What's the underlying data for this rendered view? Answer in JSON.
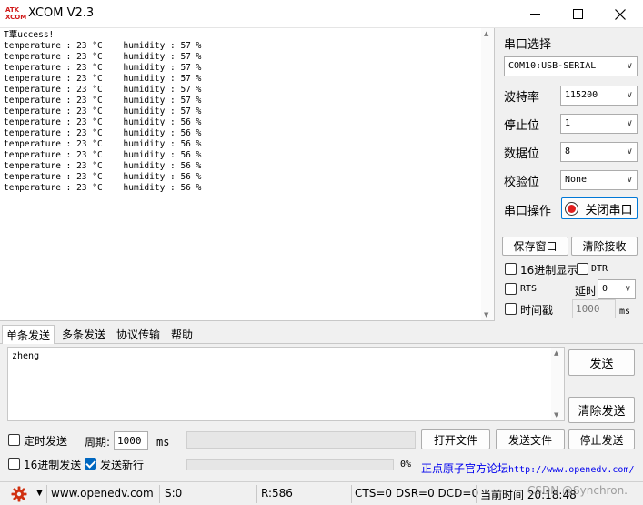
{
  "window": {
    "title": "XCOM V2.3",
    "logo_line1": "ATK",
    "logo_line2": "XCOM"
  },
  "receive": {
    "lines": [
      "T覃uccess!",
      "temperature : 23 °C    humidity : 57 %",
      "temperature : 23 °C    humidity : 57 %",
      "temperature : 23 °C    humidity : 57 %",
      "temperature : 23 °C    humidity : 57 %",
      "temperature : 23 °C    humidity : 57 %",
      "temperature : 23 °C    humidity : 57 %",
      "temperature : 23 °C    humidity : 57 %",
      "temperature : 23 °C    humidity : 56 %",
      "temperature : 23 °C    humidity : 56 %",
      "temperature : 23 °C    humidity : 56 %",
      "temperature : 23 °C    humidity : 56 %",
      "temperature : 23 °C    humidity : 56 %",
      "temperature : 23 °C    humidity : 56 %",
      "temperature : 23 °C    humidity : 56 %"
    ]
  },
  "right_panel": {
    "port_select_label": "串口选择",
    "port_value": "COM10:USB-SERIAL",
    "baud_label": "波特率",
    "baud_value": "115200",
    "stopbit_label": "停止位",
    "stopbit_value": "1",
    "databit_label": "数据位",
    "databit_value": "8",
    "parity_label": "校验位",
    "parity_value": "None",
    "port_op_label": "串口操作",
    "close_port_button": "关闭串口",
    "save_window_button": "保存窗口",
    "clear_receive_button": "清除接收",
    "hex_display_label": "16进制显示",
    "dtr_label": "DTR",
    "rts_label": "RTS",
    "delay_label": "延时",
    "delay_value": "0",
    "timestamp_label": "时间戳",
    "timestamp_value": "1000",
    "timestamp_unit": "ms"
  },
  "tabs": [
    "单条发送",
    "多条发送",
    "协议传输",
    "帮助"
  ],
  "send": {
    "text": "zheng",
    "send_button": "发送",
    "clear_send_button": "清除发送",
    "timed_send_label": "定时发送",
    "period_label": "周期:",
    "period_value": "1000",
    "period_unit": "ms",
    "open_file_button": "打开文件",
    "send_file_button": "发送文件",
    "stop_send_button": "停止发送",
    "hex_send_label": "16进制发送",
    "send_newline_label": "发送新行",
    "send_newline_checked": true,
    "progress_text": "0%",
    "progress": 0,
    "forum_link_cn": "正点原子官方论坛",
    "forum_link_url": "http://www.openedv.com/"
  },
  "status": {
    "website": "www.openedv.com",
    "sent": "S:0",
    "received": "R:586",
    "lines": "CTS=0 DSR=0 DCD=0",
    "time": "当前时间 20:18:48",
    "watermark": "CSDN @Synchron."
  },
  "colors": {
    "accent": "#0078d7",
    "led": "#e02020",
    "link": "#0000ee",
    "gear": "#d03010"
  }
}
